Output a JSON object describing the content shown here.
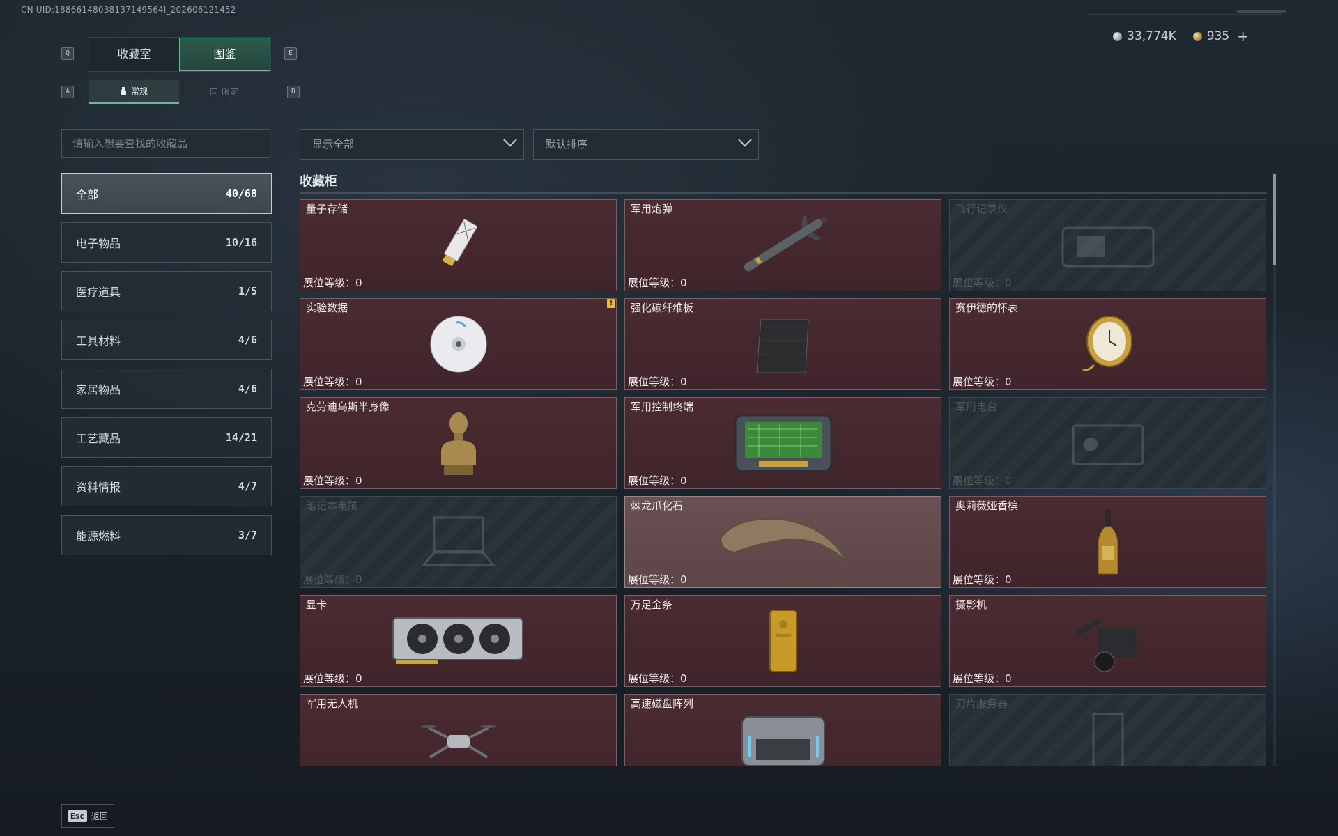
{
  "uid_text": "CN UID:18866148038137149564l_202606121452",
  "currency": {
    "silver": "33,774K",
    "gold": "935",
    "plus": "+"
  },
  "keys": {
    "q": "Q",
    "e": "E",
    "a": "A",
    "d": "D"
  },
  "main_tabs": [
    {
      "label": "收藏室"
    },
    {
      "label": "图鉴"
    }
  ],
  "sub_tabs": [
    {
      "label": "常规"
    },
    {
      "label": "限定"
    }
  ],
  "search": {
    "placeholder": "请输入想要查找的收藏品"
  },
  "filter": {
    "value": "显示全部"
  },
  "sort": {
    "value": "默认排序"
  },
  "categories": [
    {
      "label": "全部",
      "count": "40/68"
    },
    {
      "label": "电子物品",
      "count": "10/16"
    },
    {
      "label": "医疗道具",
      "count": "1/5"
    },
    {
      "label": "工具材料",
      "count": "4/6"
    },
    {
      "label": "家居物品",
      "count": "4/6"
    },
    {
      "label": "工艺藏品",
      "count": "14/21"
    },
    {
      "label": "资料情报",
      "count": "4/7"
    },
    {
      "label": "能源燃料",
      "count": "3/7"
    }
  ],
  "section_title": "收藏柜",
  "level_label": "展位等级：0",
  "items": [
    {
      "name": "量子存储"
    },
    {
      "name": "军用炮弹"
    },
    {
      "name": "飞行记录仪"
    },
    {
      "name": "实验数据",
      "badge": "!"
    },
    {
      "name": "强化碳纤维板"
    },
    {
      "name": "赛伊德的怀表"
    },
    {
      "name": "克劳迪乌斯半身像"
    },
    {
      "name": "军用控制终端"
    },
    {
      "name": "军用电台"
    },
    {
      "name": "笔记本电脑"
    },
    {
      "name": "棘龙爪化石"
    },
    {
      "name": "奥莉薇娅香槟"
    },
    {
      "name": "显卡"
    },
    {
      "name": "万足金条"
    },
    {
      "name": "摄影机"
    },
    {
      "name": "军用无人机"
    },
    {
      "name": "高速磁盘阵列"
    },
    {
      "name": "刀片服务器"
    }
  ],
  "footer": {
    "esc_key": "Esc",
    "back_label": "返回"
  }
}
